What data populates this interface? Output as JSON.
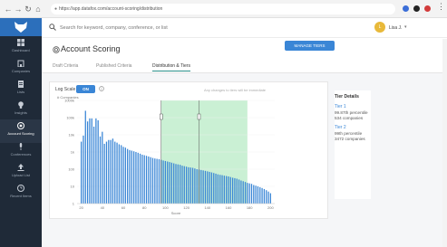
{
  "browser": {
    "url": "https://app.datafox.com/account-scoring/distribution",
    "back_icon": "arrow-left",
    "forward_icon": "arrow-right",
    "reload_icon": "reload",
    "home_icon": "home"
  },
  "sidebar": {
    "logo": "fox-logo",
    "items": [
      {
        "label": "Dashboard",
        "icon": "dashboard-icon"
      },
      {
        "label": "Companies",
        "icon": "building-icon"
      },
      {
        "label": "Lists",
        "icon": "list-icon"
      },
      {
        "label": "Insights",
        "icon": "bulb-icon"
      },
      {
        "label": "Account Scoring",
        "icon": "target-icon",
        "active": true
      },
      {
        "label": "Conferences",
        "icon": "mic-icon"
      },
      {
        "label": "Upload List",
        "icon": "upload-icon"
      },
      {
        "label": "Recent Items",
        "icon": "clock-icon"
      }
    ]
  },
  "topbar": {
    "search_placeholder": "Search for keyword, company, conference, or list",
    "avatar_initial": "L",
    "user_name": "Lisa J."
  },
  "page": {
    "title": "Account Scoring",
    "tabs": [
      {
        "label": "Draft Criteria"
      },
      {
        "label": "Published Criteria"
      },
      {
        "label": "Distribution & Tiers",
        "active": true
      }
    ]
  },
  "controls": {
    "log_scale_label": "Log Scale",
    "toggle_label": "ON",
    "notice": "Any changes to tiers will be immediate",
    "manage_button": "MANAGE TIERS"
  },
  "tiers": {
    "title": "Tier Details",
    "items": [
      {
        "name": "Tier 1",
        "percentile": "99.87th percentile",
        "companies": "534 companies"
      },
      {
        "name": "Tier 2",
        "percentile": "99th percentile",
        "companies": "3472 companies"
      }
    ]
  },
  "chart_data": {
    "type": "bar",
    "ylabel": "# Companies",
    "xlabel": "Score",
    "log_scale": true,
    "y_ticks": [
      "1000k",
      "100k",
      "10k",
      "1k",
      "100",
      "10",
      "1"
    ],
    "x_ticks": [
      "20",
      "40",
      "60",
      "80",
      "100",
      "120",
      "140",
      "160",
      "180",
      "200"
    ],
    "x": [
      20,
      22,
      24,
      26,
      28,
      30,
      32,
      34,
      36,
      38,
      40,
      42,
      44,
      46,
      48,
      50,
      52,
      54,
      56,
      58,
      60,
      62,
      64,
      66,
      68,
      70,
      72,
      74,
      76,
      78,
      80,
      82,
      84,
      86,
      88,
      90,
      92,
      94,
      96,
      98,
      100,
      102,
      104,
      106,
      108,
      110,
      112,
      114,
      116,
      118,
      120,
      122,
      124,
      126,
      128,
      130,
      132,
      134,
      136,
      138,
      140,
      142,
      144,
      146,
      148,
      150,
      152,
      154,
      156,
      158,
      160,
      162,
      164,
      166,
      168,
      170,
      172,
      174,
      176,
      178,
      180,
      182,
      184,
      186,
      188,
      190,
      192,
      194,
      196,
      198,
      200
    ],
    "values": [
      4000,
      9000,
      250000,
      60000,
      90000,
      90000,
      30000,
      90000,
      70000,
      8000,
      15000,
      3000,
      4000,
      5000,
      5000,
      6000,
      4000,
      3500,
      2800,
      2500,
      2000,
      1800,
      1500,
      1300,
      1200,
      1100,
      1000,
      900,
      800,
      700,
      650,
      600,
      550,
      500,
      450,
      420,
      400,
      380,
      350,
      320,
      300,
      280,
      260,
      240,
      220,
      200,
      190,
      180,
      160,
      150,
      140,
      130,
      125,
      120,
      110,
      100,
      95,
      90,
      85,
      80,
      75,
      70,
      65,
      60,
      55,
      50,
      47,
      45,
      42,
      40,
      38,
      35,
      32,
      30,
      28,
      25,
      22,
      20,
      18,
      16,
      15,
      14,
      12,
      11,
      10,
      9,
      8,
      7,
      6,
      5,
      4
    ],
    "highlight_range": [
      96,
      178
    ],
    "tier_markers": [
      96,
      132
    ],
    "accent_color": "#3a86d6",
    "highlight_color": "#bdecc9",
    "bar_color": "#3a86d6"
  }
}
